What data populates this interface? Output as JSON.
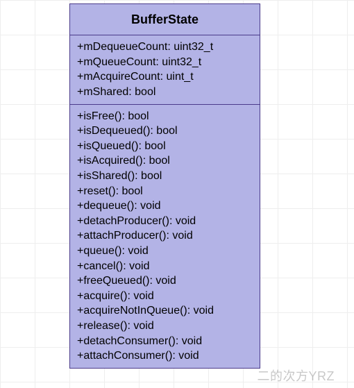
{
  "class": {
    "name": "BufferState",
    "attributes": [
      "+mDequeueCount: uint32_t",
      "+mQueueCount: uint32_t",
      "+mAcquireCount: uint_t",
      "+mShared: bool"
    ],
    "operations": [
      "+isFree(): bool",
      "+isDequeued(): bool",
      "+isQueued(): bool",
      "+isAcquired(): bool",
      "+isShared(): bool",
      "+reset(): bool",
      "+dequeue(): void",
      "+detachProducer(): void",
      "+attachProducer(): void",
      "+queue(): void",
      "+cancel(): void",
      "+freeQueued(): void",
      "+acquire(): void",
      "+acquireNotInQueue(): void",
      "+release(): void",
      "+detachConsumer(): void",
      "+attachConsumer(): void"
    ]
  },
  "watermark": "二的次方YRZ"
}
